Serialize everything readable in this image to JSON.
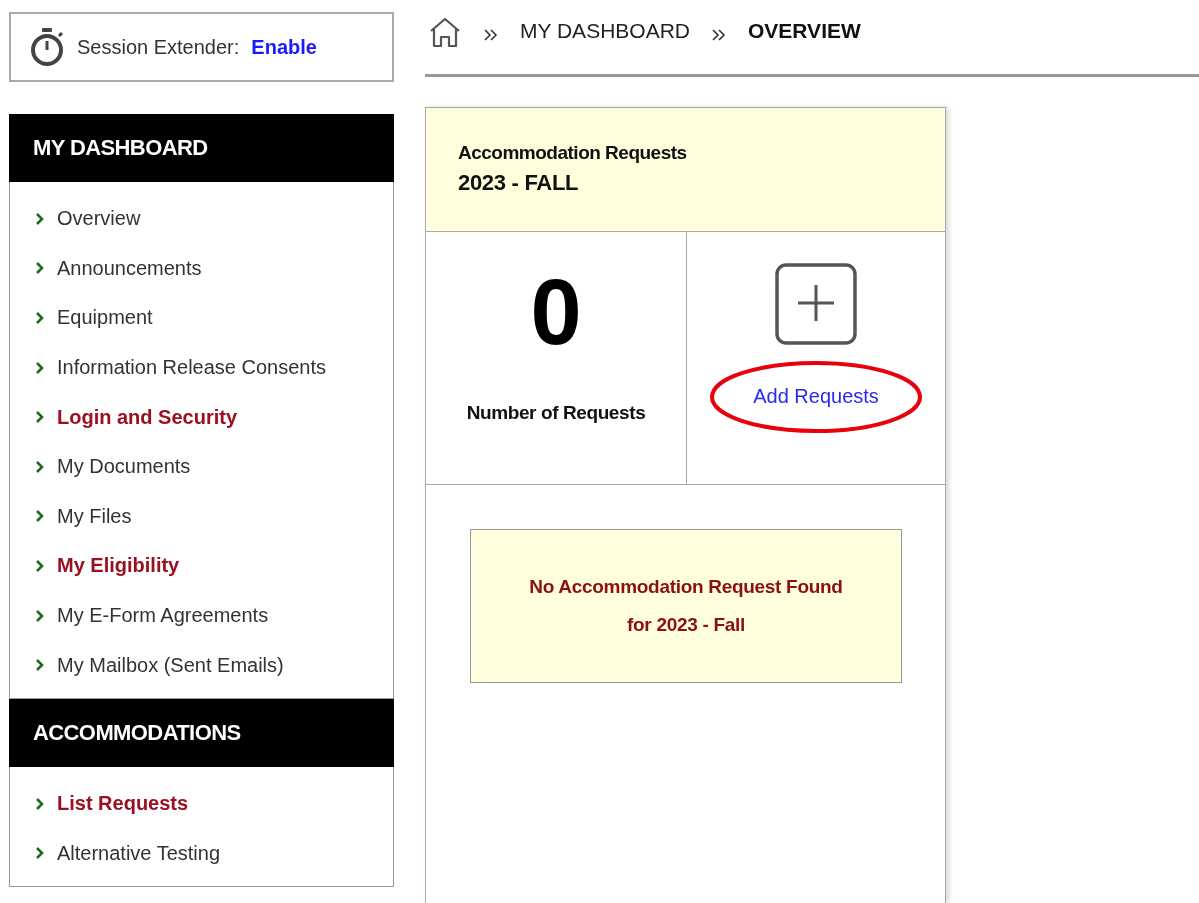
{
  "session": {
    "label": "Session Extender:",
    "action": "Enable"
  },
  "sidebar": [
    {
      "title": "MY DASHBOARD",
      "items": [
        {
          "label": "Overview",
          "highlighted": false
        },
        {
          "label": "Announcements",
          "highlighted": false
        },
        {
          "label": "Equipment",
          "highlighted": false
        },
        {
          "label": "Information Release Consents",
          "highlighted": false
        },
        {
          "label": "Login and Security",
          "highlighted": true
        },
        {
          "label": "My Documents",
          "highlighted": false
        },
        {
          "label": "My Files",
          "highlighted": false
        },
        {
          "label": "My Eligibility",
          "highlighted": true
        },
        {
          "label": "My E-Form Agreements",
          "highlighted": false
        },
        {
          "label": "My Mailbox (Sent Emails)",
          "highlighted": false
        }
      ]
    },
    {
      "title": "ACCOMMODATIONS",
      "items": [
        {
          "label": "List Requests",
          "highlighted": true
        },
        {
          "label": "Alternative Testing",
          "highlighted": false
        }
      ]
    }
  ],
  "breadcrumb": [
    {
      "label": "MY DASHBOARD",
      "selected": false
    },
    {
      "label": "OVERVIEW",
      "selected": true
    }
  ],
  "card": {
    "title": "Accommodation Requests",
    "term": "2023 - FALL",
    "count": "0",
    "count_label": "Number of Requests",
    "add_action": {
      "label": "Add Requests",
      "circled": true
    },
    "message": [
      "No Accommodation Request Found",
      "for 2023 - Fall"
    ]
  }
}
